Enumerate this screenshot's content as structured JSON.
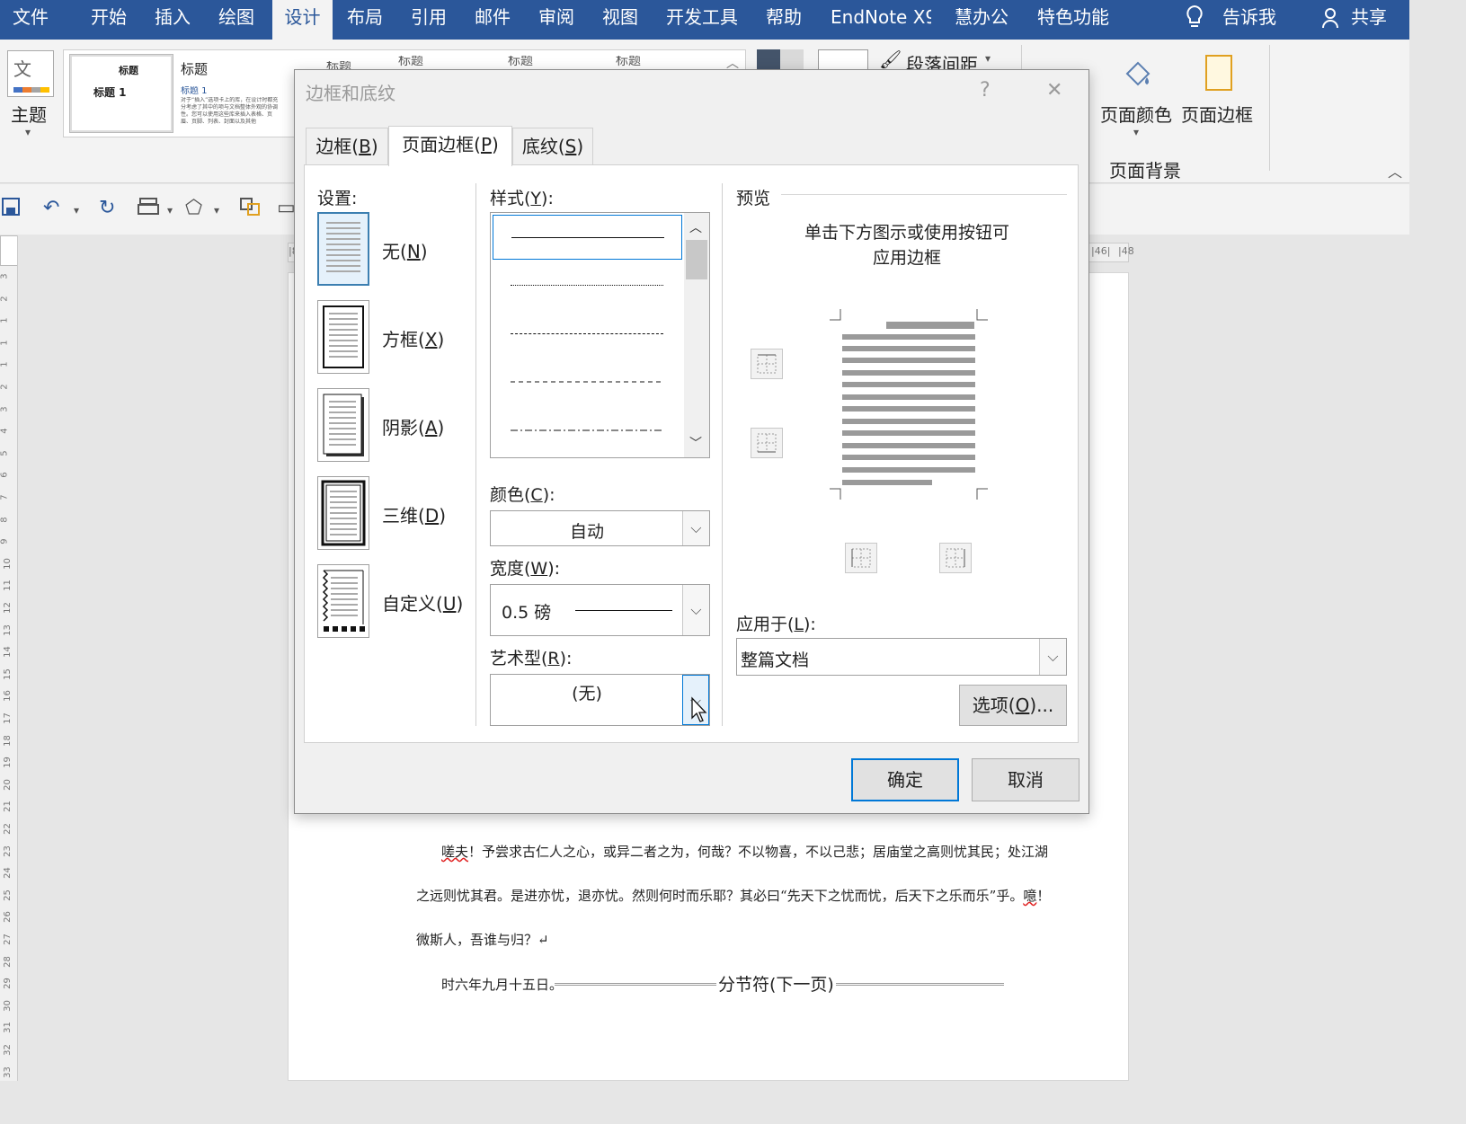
{
  "ribbon": {
    "tabs": [
      "文件",
      "开始",
      "插入",
      "绘图",
      "设计",
      "布局",
      "引用",
      "邮件",
      "审阅",
      "视图",
      "开发工具",
      "帮助",
      "EndNote X9",
      "慧办公",
      "特色功能"
    ],
    "active_tab": "设计",
    "tell_me": "告诉我",
    "share": "共享",
    "theme_label": "主题",
    "gallery": {
      "thumb1_title": "标题",
      "thumb1_heading": "标题 1",
      "thumb2_title": "标题",
      "thumb2_heading": "标题 1",
      "thumb2_text": "对于“插入”选项卡上的库，在设计时都充分考虑了其中的项与文档整体外观的协调性。您可以使用这些库来插入表格、页眉、页脚、列表、封面以及其他",
      "more_titles": [
        "标题",
        "标题",
        "标题",
        "标题"
      ]
    },
    "paragraph_spacing": "段落间距",
    "page_color": "页面颜色",
    "page_borders": "页面边框",
    "page_background_group": "页面背景"
  },
  "ruler": {
    "h_ticks": [
      "|8",
      "|46|",
      "|48"
    ],
    "v_ticks": [
      "3",
      "2",
      "1",
      "1",
      "1",
      "2",
      "3",
      "4",
      "5",
      "6",
      "7",
      "8",
      "9",
      "10",
      "11",
      "12",
      "13",
      "14",
      "15",
      "16",
      "17",
      "18",
      "19",
      "20",
      "21",
      "22",
      "23",
      "24",
      "25",
      "26",
      "27",
      "28",
      "29",
      "30",
      "31",
      "32",
      "33"
    ]
  },
  "document": {
    "line1_pre": "",
    "line1_wavy": "嗟夫",
    "line1_post": "！予尝求古仁人之心，或异二者之为，何哉？不以物喜，不以己悲；居庙堂之高则忧其民；处江湖",
    "line2_pre": "之远则忧其君。是进亦忧，退亦忧。然则何时而乐耶？其必曰“先天下之忧而忧，后天下之乐而乐”乎。",
    "line2_wavy": "噫",
    "line2_post": "！",
    "line3": "微斯人，吾谁与归？↵",
    "line4_text": "时六年九月十五日。",
    "section_break": "分节符(下一页)"
  },
  "dialog": {
    "title": "边框和底纹",
    "help": "?",
    "close": "✕",
    "tabs": [
      {
        "text": "边框(",
        "key": "B",
        "end": ")"
      },
      {
        "text": "页面边框(",
        "key": "P",
        "end": ")"
      },
      {
        "text": "底纹(",
        "key": "S",
        "end": ")"
      }
    ],
    "settings_label": {
      "text": "设置:",
      "key": "",
      "end": ""
    },
    "settings": [
      {
        "text": "无(",
        "key": "N",
        "end": ")"
      },
      {
        "text": "方框(",
        "key": "X",
        "end": ")"
      },
      {
        "text": "阴影(",
        "key": "A",
        "end": ")"
      },
      {
        "text": "三维(",
        "key": "D",
        "end": ")"
      },
      {
        "text": "自定义(",
        "key": "U",
        "end": ")"
      }
    ],
    "style_label": {
      "text": "样式(",
      "key": "Y",
      "end": "):"
    },
    "color_label": {
      "text": "颜色(",
      "key": "C",
      "end": "):"
    },
    "color_value": "自动",
    "width_label": {
      "text": "宽度(",
      "key": "W",
      "end": "):"
    },
    "width_value": "0.5 磅",
    "art_label": {
      "text": "艺术型(",
      "key": "R",
      "end": "):"
    },
    "art_value": "(无)",
    "preview_label": "预览",
    "preview_hint_line1": "单击下方图示或使用按钮可",
    "preview_hint_line2": "应用边框",
    "apply_label": {
      "text": "应用于(",
      "key": "L",
      "end": "):"
    },
    "apply_value": "整篇文档",
    "options_button": {
      "text": "选项(",
      "key": "O",
      "end": ")..."
    },
    "ok": "确定",
    "cancel": "取消"
  },
  "colors": {
    "ribbon_blue": "#2b579a",
    "selection_blue": "#0078d7",
    "dialog_bg": "#f0f0f0"
  }
}
